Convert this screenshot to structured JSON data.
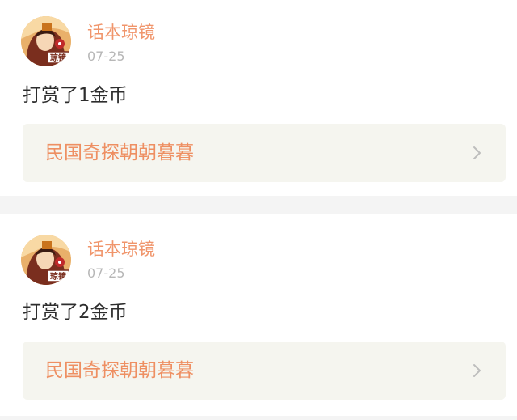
{
  "posts": [
    {
      "author": "话本琼镜",
      "avatar_text": "琼镜",
      "date": "07-25",
      "message": "打赏了1金币",
      "book_title": "民国奇探朝朝暮暮"
    },
    {
      "author": "话本琼镜",
      "avatar_text": "琼镜",
      "date": "07-25",
      "message": "打赏了2金币",
      "book_title": "民国奇探朝朝暮暮"
    }
  ],
  "icons": {
    "avatar": "avatar-image",
    "chevron": "chevron-right-icon"
  },
  "colors": {
    "author": "#f0956b",
    "book_title": "#ee8f62",
    "date": "#b7b7b7",
    "link_background": "#f5f5ef",
    "page_background": "#f4f4f4"
  }
}
